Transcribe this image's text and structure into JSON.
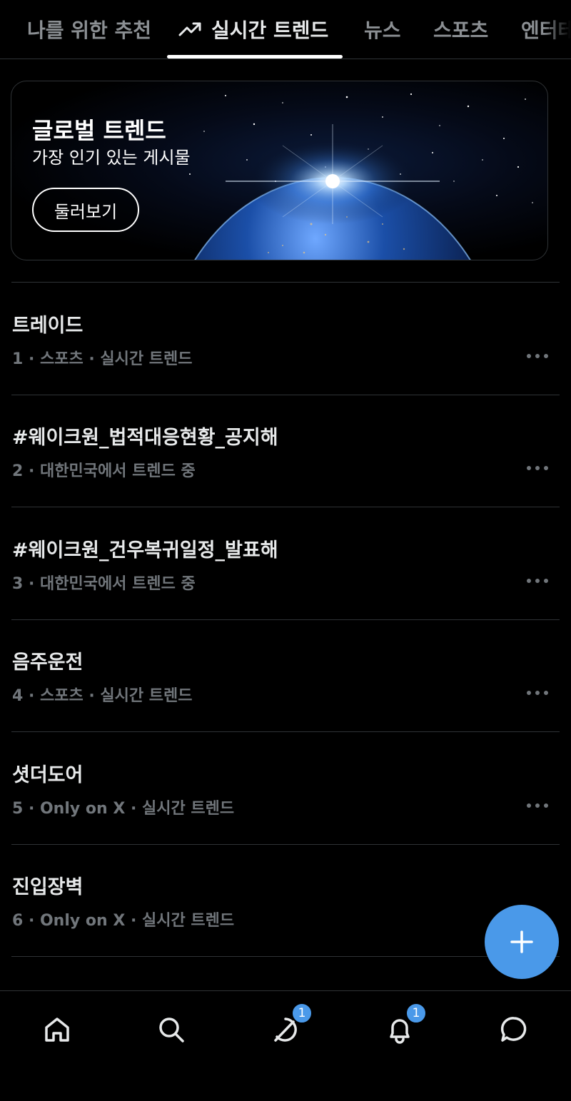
{
  "tabs": [
    {
      "label": "나를 위한 추천",
      "active": false
    },
    {
      "label": "실시간 트렌드",
      "active": true
    },
    {
      "label": "뉴스",
      "active": false
    },
    {
      "label": "스포츠",
      "active": false
    },
    {
      "label": "엔터테",
      "active": false
    }
  ],
  "hero": {
    "title": "글로벌 트렌드",
    "subtitle": "가장 인기 있는 게시물",
    "button": "둘러보기"
  },
  "trends": [
    {
      "name": "트레이드",
      "meta": "1 · 스포츠 · 실시간 트렌드"
    },
    {
      "name": "#웨이크원_법적대응현황_공지해",
      "meta": "2 · 대한민국에서 트렌드 중"
    },
    {
      "name": "#웨이크원_건우복귀일정_발표해",
      "meta": "3 · 대한민국에서 트렌드 중"
    },
    {
      "name": "음주운전",
      "meta": "4 · 스포츠 · 실시간 트렌드"
    },
    {
      "name": "셧더도어",
      "meta": "5 · Only on X · 실시간 트렌드"
    },
    {
      "name": "진입장벽",
      "meta": "6 · Only on X · 실시간 트렌드"
    }
  ],
  "bottom_nav": {
    "items": [
      "home-icon",
      "search-icon",
      "grok-icon",
      "bell-icon",
      "message-icon"
    ],
    "grok_badge": "1",
    "notifications_badge": "1"
  },
  "colors": {
    "accent": "#4a99e9",
    "muted": "#71767b",
    "divider": "#2f3336"
  }
}
